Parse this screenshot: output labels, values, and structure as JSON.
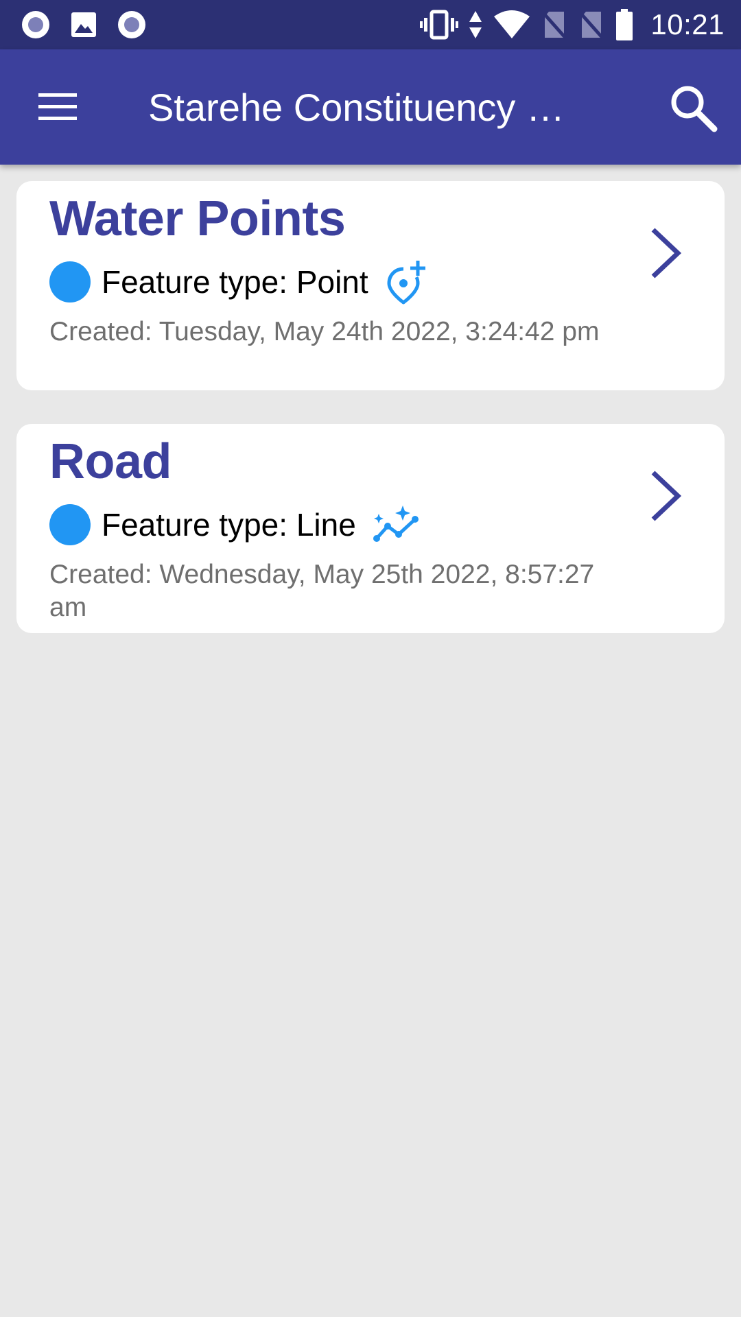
{
  "status_bar": {
    "time": "10:21",
    "left_icons": [
      "record-icon",
      "image-icon",
      "record-icon"
    ],
    "right_icons": [
      "vibrate-icon",
      "data-arrows-icon",
      "wifi-icon",
      "no-sim-icon",
      "no-sim-icon",
      "battery-icon"
    ]
  },
  "app_bar": {
    "title": "Starehe Constituency  …",
    "menu_icon": "menu-icon",
    "search_icon": "search-icon"
  },
  "colors": {
    "status_bar": "#2c3074",
    "app_bar": "#3c409c",
    "accent": "#3c409c",
    "dot": "#2196f3",
    "background": "#e8e8e8"
  },
  "layers": [
    {
      "name": "Water Points",
      "feature_type": "Feature type: Point",
      "feature_icon": "add-location-icon",
      "created": "Created: Tuesday, May 24th 2022, 3:24:42 pm"
    },
    {
      "name": "Road",
      "feature_type": "Feature type: Line",
      "feature_icon": "polyline-sparkle-icon",
      "created": "Created: Wednesday, May 25th 2022, 8:57:27 am"
    }
  ]
}
